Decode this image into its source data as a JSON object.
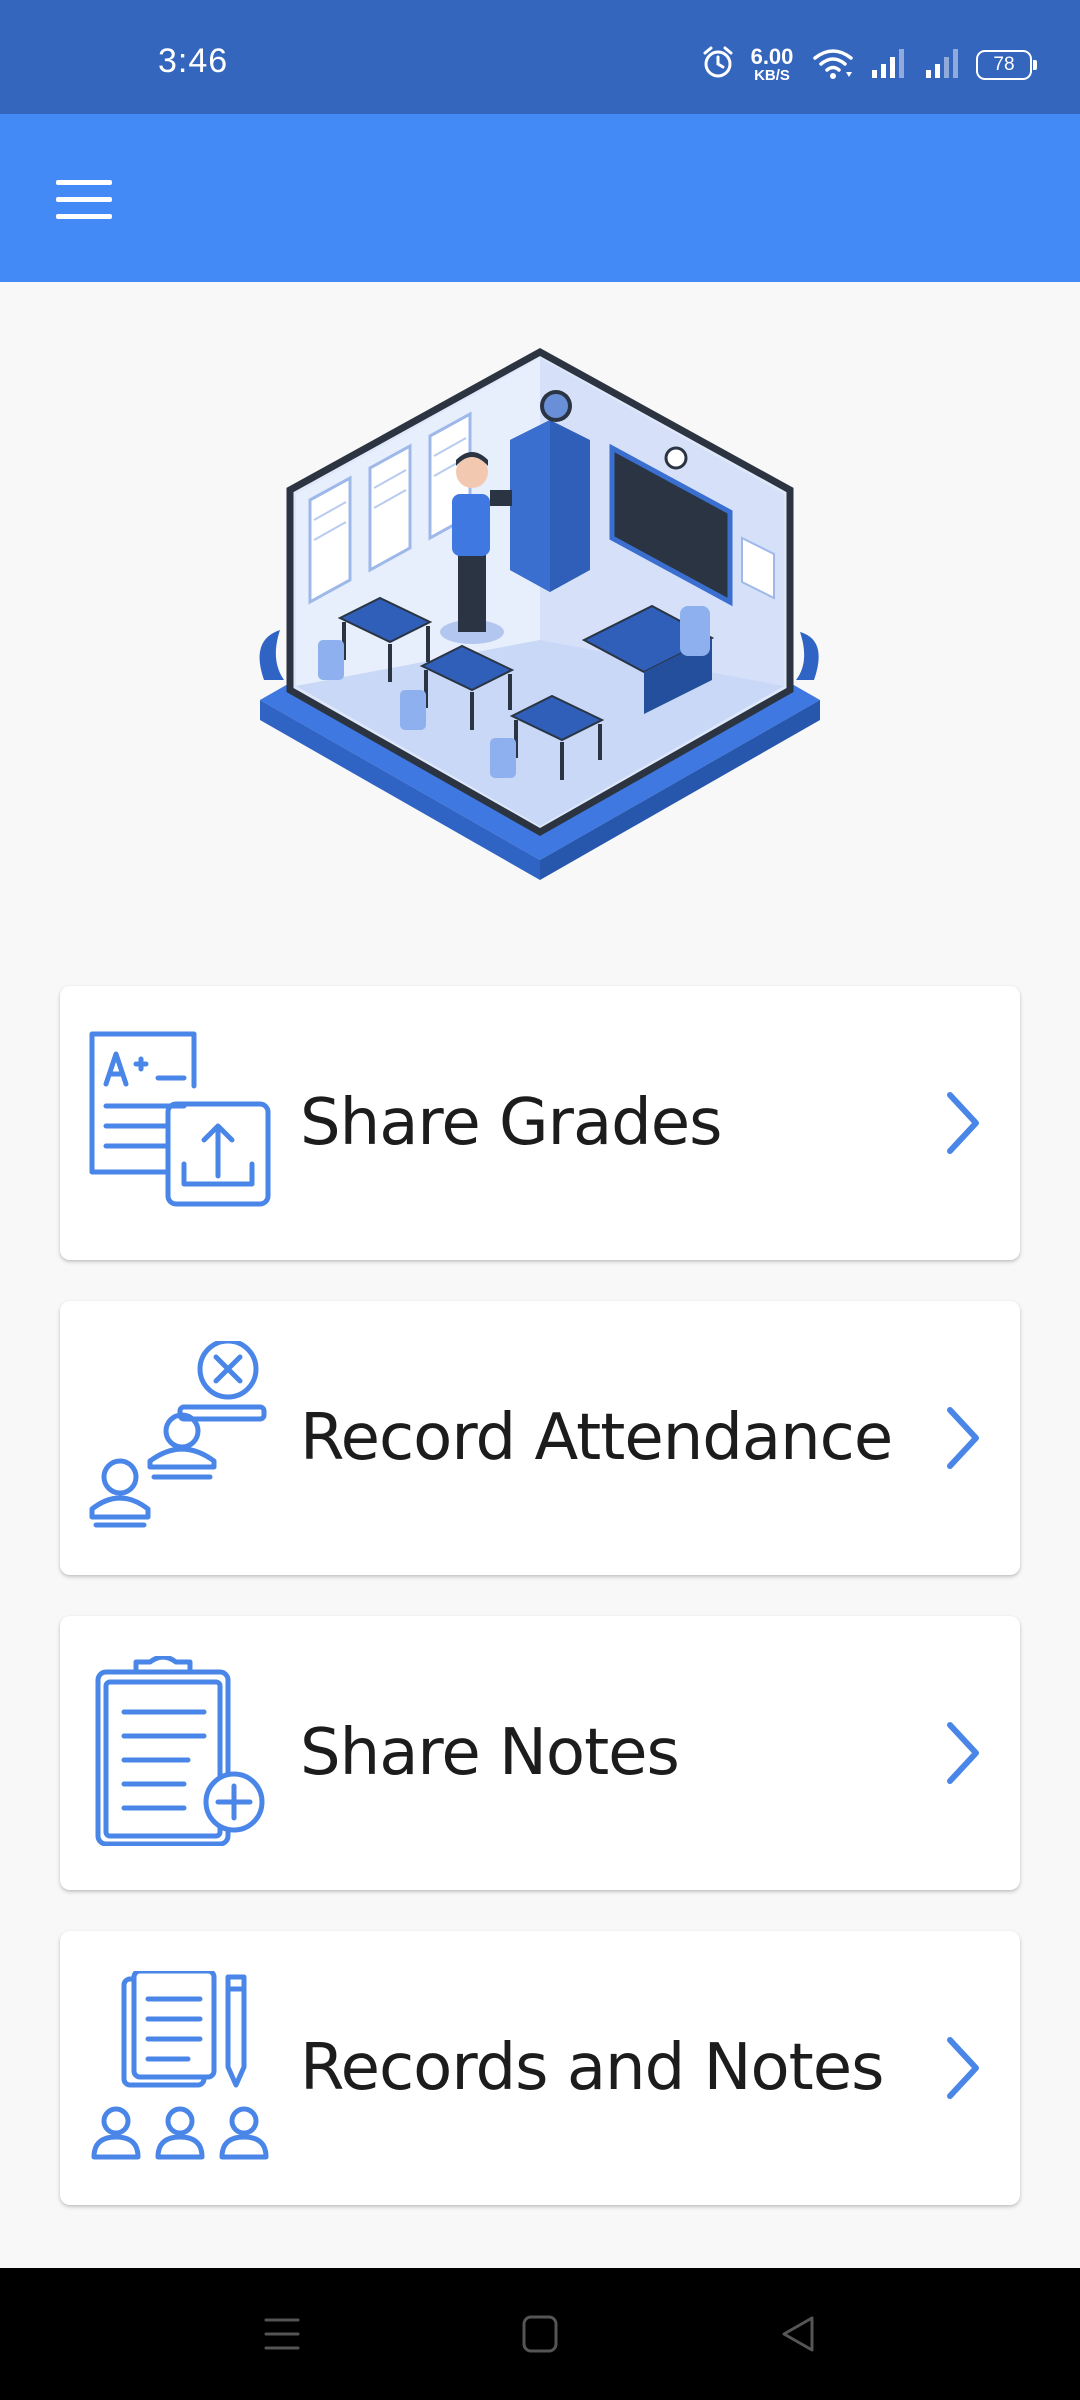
{
  "status_bar": {
    "time": "3:46",
    "net_speed_value": "6.00",
    "net_speed_unit": "KB/S",
    "battery_level": "78",
    "icons": [
      "alarm-icon",
      "wifi-icon",
      "signal-icon",
      "signal-icon"
    ]
  },
  "app_bar": {
    "menu_icon": "hamburger-menu-icon",
    "color": "#448af6"
  },
  "hero": {
    "illustration": "classroom-illustration"
  },
  "menu": {
    "items": [
      {
        "label": "Share Grades",
        "icon": "share-grades-icon"
      },
      {
        "label": "Record Attendance",
        "icon": "record-attendance-icon"
      },
      {
        "label": "Share Notes",
        "icon": "share-notes-icon"
      },
      {
        "label": "Records and Notes",
        "icon": "records-and-notes-icon"
      }
    ],
    "chevron_icon": "chevron-right-icon",
    "accent_color": "#4a86e8"
  },
  "nav_bar": {
    "buttons": [
      "recents-icon",
      "home-icon",
      "back-icon"
    ]
  },
  "colors": {
    "status_bar": "#3566bd",
    "app_bar": "#448af6",
    "background": "#f8f8f8",
    "card": "#ffffff",
    "text": "#1c1c1c"
  }
}
